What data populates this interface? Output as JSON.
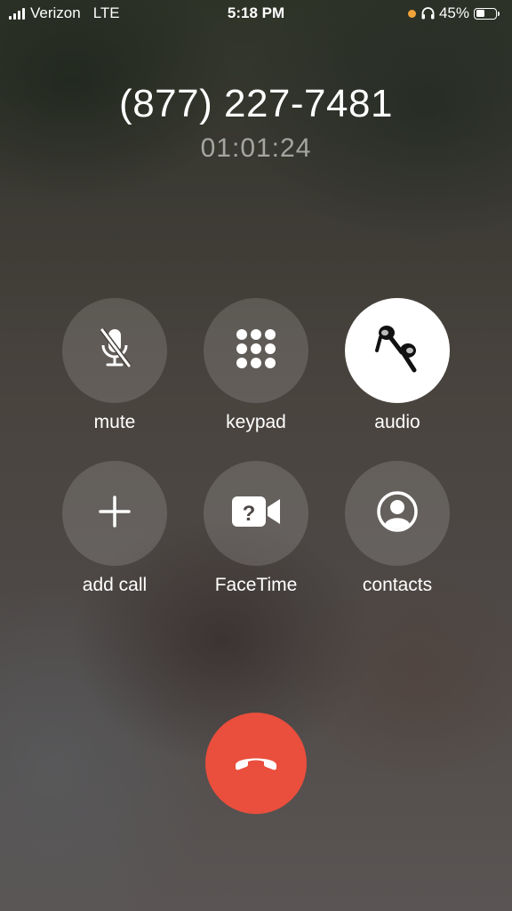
{
  "status_bar": {
    "carrier": "Verizon",
    "network": "LTE",
    "time": "5:18 PM",
    "battery_percent": "45%",
    "battery_level": 0.45,
    "signal_bars": 4,
    "headphones_icon": "headphones-icon",
    "privacy_indicator_color": "#f2a33a"
  },
  "call": {
    "number": "(877) 227-7481",
    "duration": "01:01:24"
  },
  "controls": [
    {
      "label": "mute",
      "icon": "mic-slash-icon",
      "active": false
    },
    {
      "label": "keypad",
      "icon": "keypad-icon",
      "active": false
    },
    {
      "label": "audio",
      "icon": "airpods-icon",
      "active": true
    },
    {
      "label": "add call",
      "icon": "plus-icon",
      "active": false
    },
    {
      "label": "FaceTime",
      "icon": "facetime-unknown-icon",
      "active": false
    },
    {
      "label": "contacts",
      "icon": "contacts-icon",
      "active": false
    }
  ],
  "end_call": {
    "icon": "end-call-icon",
    "color": "#ea4e3d"
  }
}
